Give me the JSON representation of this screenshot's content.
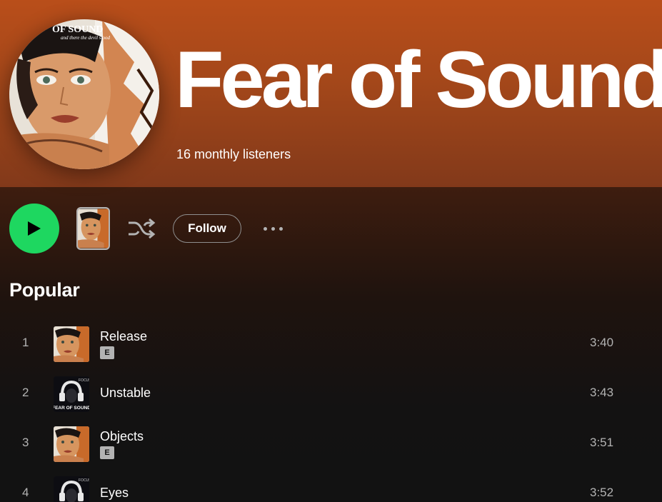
{
  "artist": {
    "name": "Fear of Sound",
    "monthly_listeners": "16 monthly listeners",
    "avatar_caption": "OF SOUND",
    "avatar_subcaption": "and there the devil stood"
  },
  "actions": {
    "follow_label": "Follow"
  },
  "popular": {
    "title": "Popular",
    "tracks": [
      {
        "number": "1",
        "title": "Release",
        "explicit": "E",
        "duration": "3:40",
        "cover": "face"
      },
      {
        "number": "2",
        "title": "Unstable",
        "explicit": "",
        "duration": "3:43",
        "cover": "headphones"
      },
      {
        "number": "3",
        "title": "Objects",
        "explicit": "E",
        "duration": "3:51",
        "cover": "face"
      },
      {
        "number": "4",
        "title": "Eyes",
        "explicit": "",
        "duration": "3:52",
        "cover": "headphones"
      }
    ]
  },
  "cover_text": {
    "headphones_top": "FOCUS",
    "headphones_bottom": "FEAR OF SOUND"
  },
  "colors": {
    "hero": "#b94e1a",
    "play_button": "#1ed760",
    "background": "#121212",
    "muted_text": "#b3b3b3"
  }
}
